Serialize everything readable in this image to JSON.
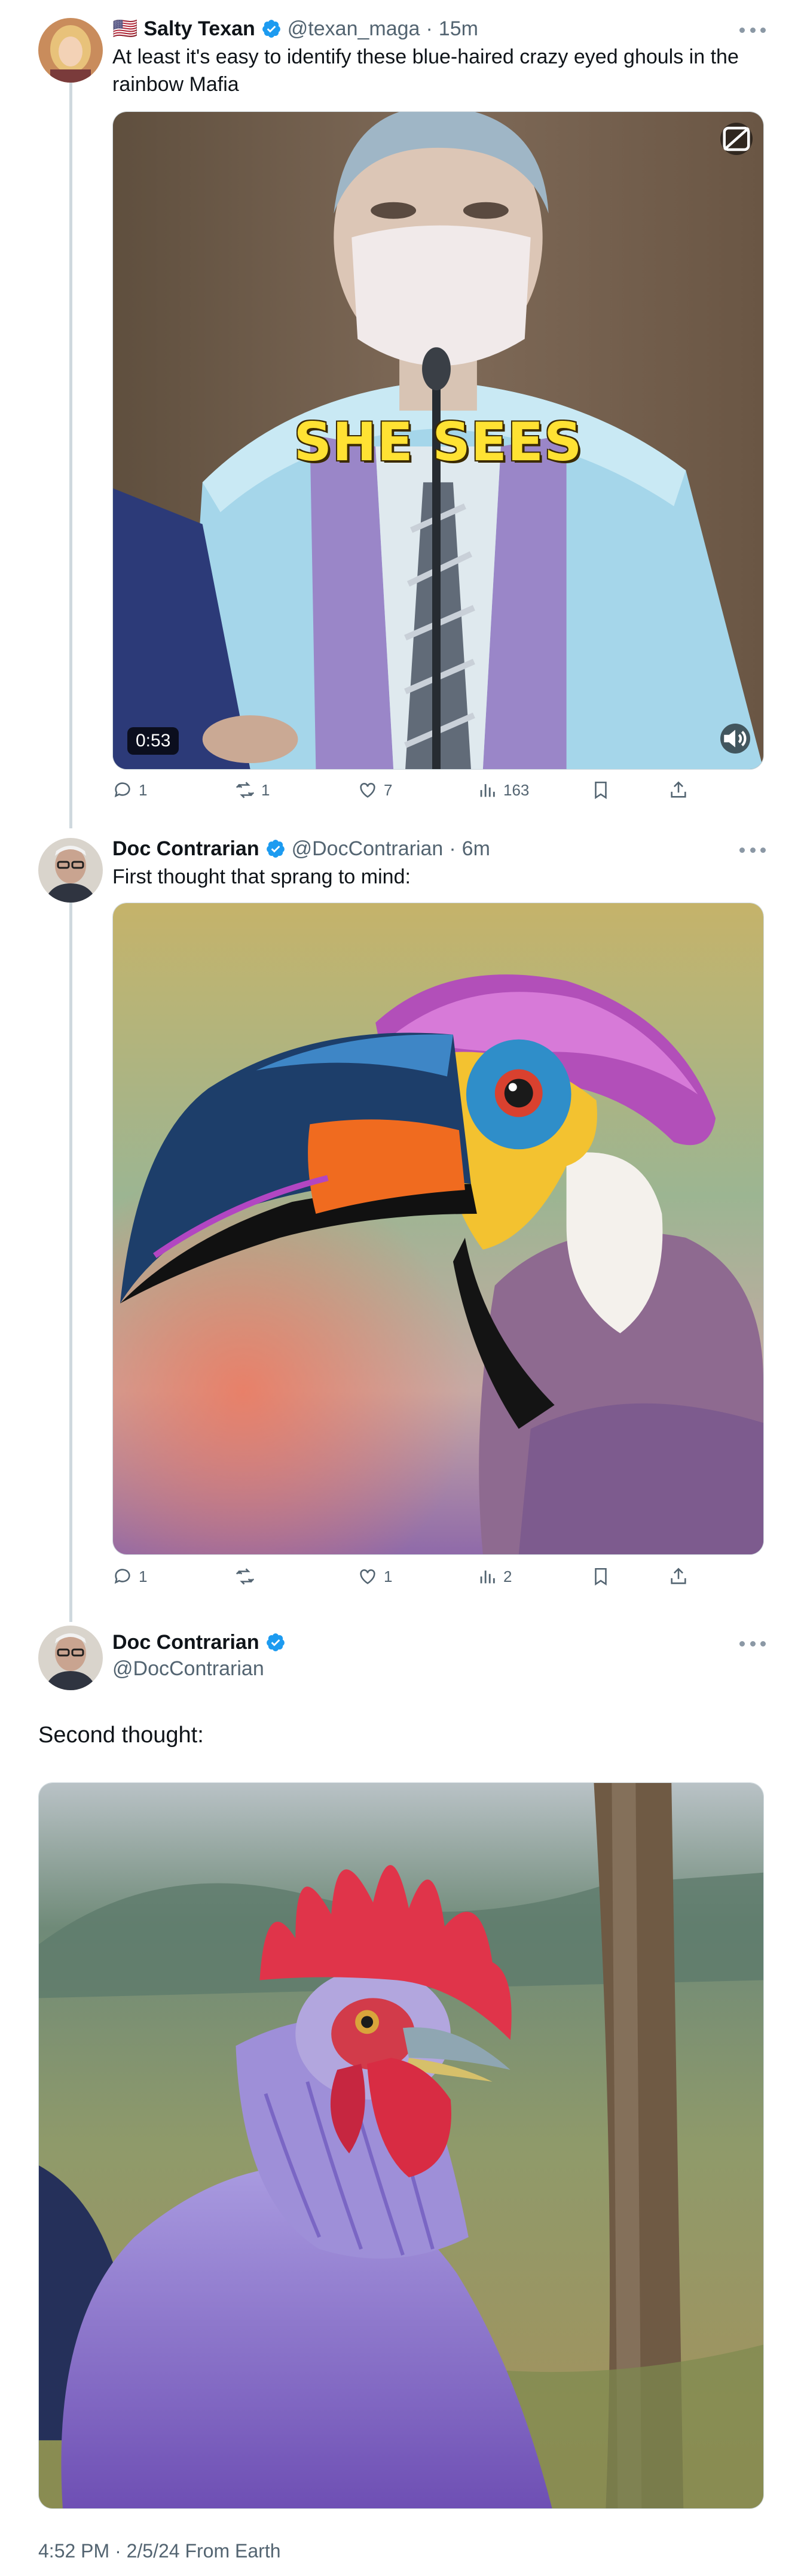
{
  "tweets": [
    {
      "flag": "🇺🇸",
      "name": "Salty Texan",
      "handle": "@texan_maga",
      "separator": "·",
      "time": "15m",
      "text": "At least it's easy to identify these blue-haired crazy eyed ghouls in the rainbow Mafia",
      "media": {
        "caption": "SHE SEES",
        "duration": "0:53"
      },
      "actions": {
        "replies": "1",
        "reposts": "1",
        "likes": "7",
        "views": "163"
      }
    },
    {
      "name": "Doc Contrarian",
      "handle": "@DocContrarian",
      "separator": "·",
      "time": "6m",
      "text": "First thought that sprang to mind:",
      "actions": {
        "replies": "1",
        "reposts": "",
        "likes": "1",
        "views": "2"
      }
    },
    {
      "name": "Doc Contrarian",
      "handle": "@DocContrarian",
      "text": "Second thought:",
      "timestamp": "4:52 PM · 2/5/24 From Earth"
    }
  ],
  "colors": {
    "verified": "#1d9bf0",
    "muted": "#536471",
    "thread": "#cfd9de"
  }
}
